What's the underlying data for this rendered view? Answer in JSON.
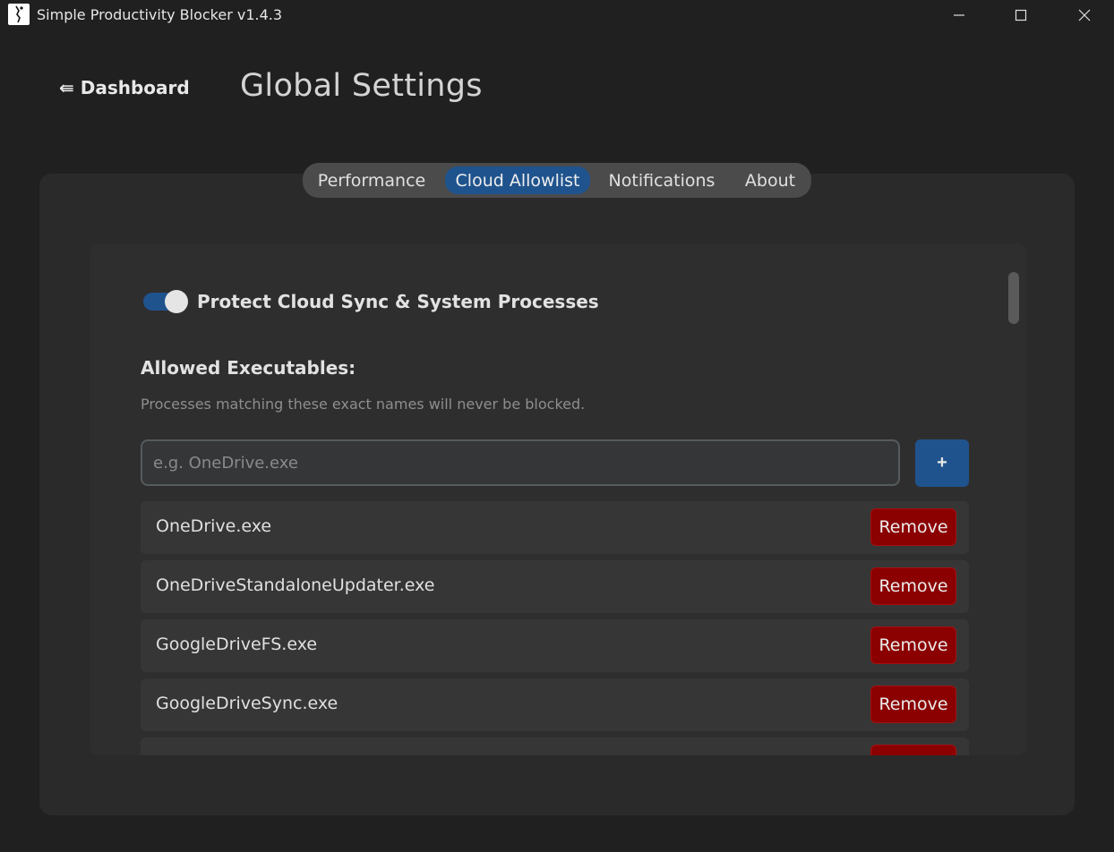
{
  "window": {
    "title": "Simple Productivity Blocker v1.4.3",
    "minimize_glyph": "—",
    "maximize_glyph": "☐",
    "close_glyph": "✕"
  },
  "header": {
    "back_label": "⇚ Dashboard",
    "page_title": "Global Settings"
  },
  "tabs": [
    {
      "label": "Performance",
      "active": false
    },
    {
      "label": "Cloud Allowlist",
      "active": true
    },
    {
      "label": "Notifications",
      "active": false
    },
    {
      "label": "About",
      "active": false
    }
  ],
  "cloud_allowlist": {
    "protect_toggle_label": "Protect Cloud Sync & System Processes",
    "protect_toggle_on": true,
    "heading": "Allowed Executables:",
    "description": "Processes matching these exact names will never be blocked.",
    "input_placeholder": "e.g. OneDrive.exe",
    "input_value": "",
    "add_label": "+",
    "remove_label": "Remove",
    "executables": [
      "OneDrive.exe",
      "OneDriveStandaloneUpdater.exe",
      "GoogleDriveFS.exe",
      "GoogleDriveSync.exe",
      ""
    ]
  },
  "colors": {
    "accent": "#1f538d",
    "danger": "#8b0000",
    "background": "#202020",
    "card": "#2a2a2a"
  }
}
